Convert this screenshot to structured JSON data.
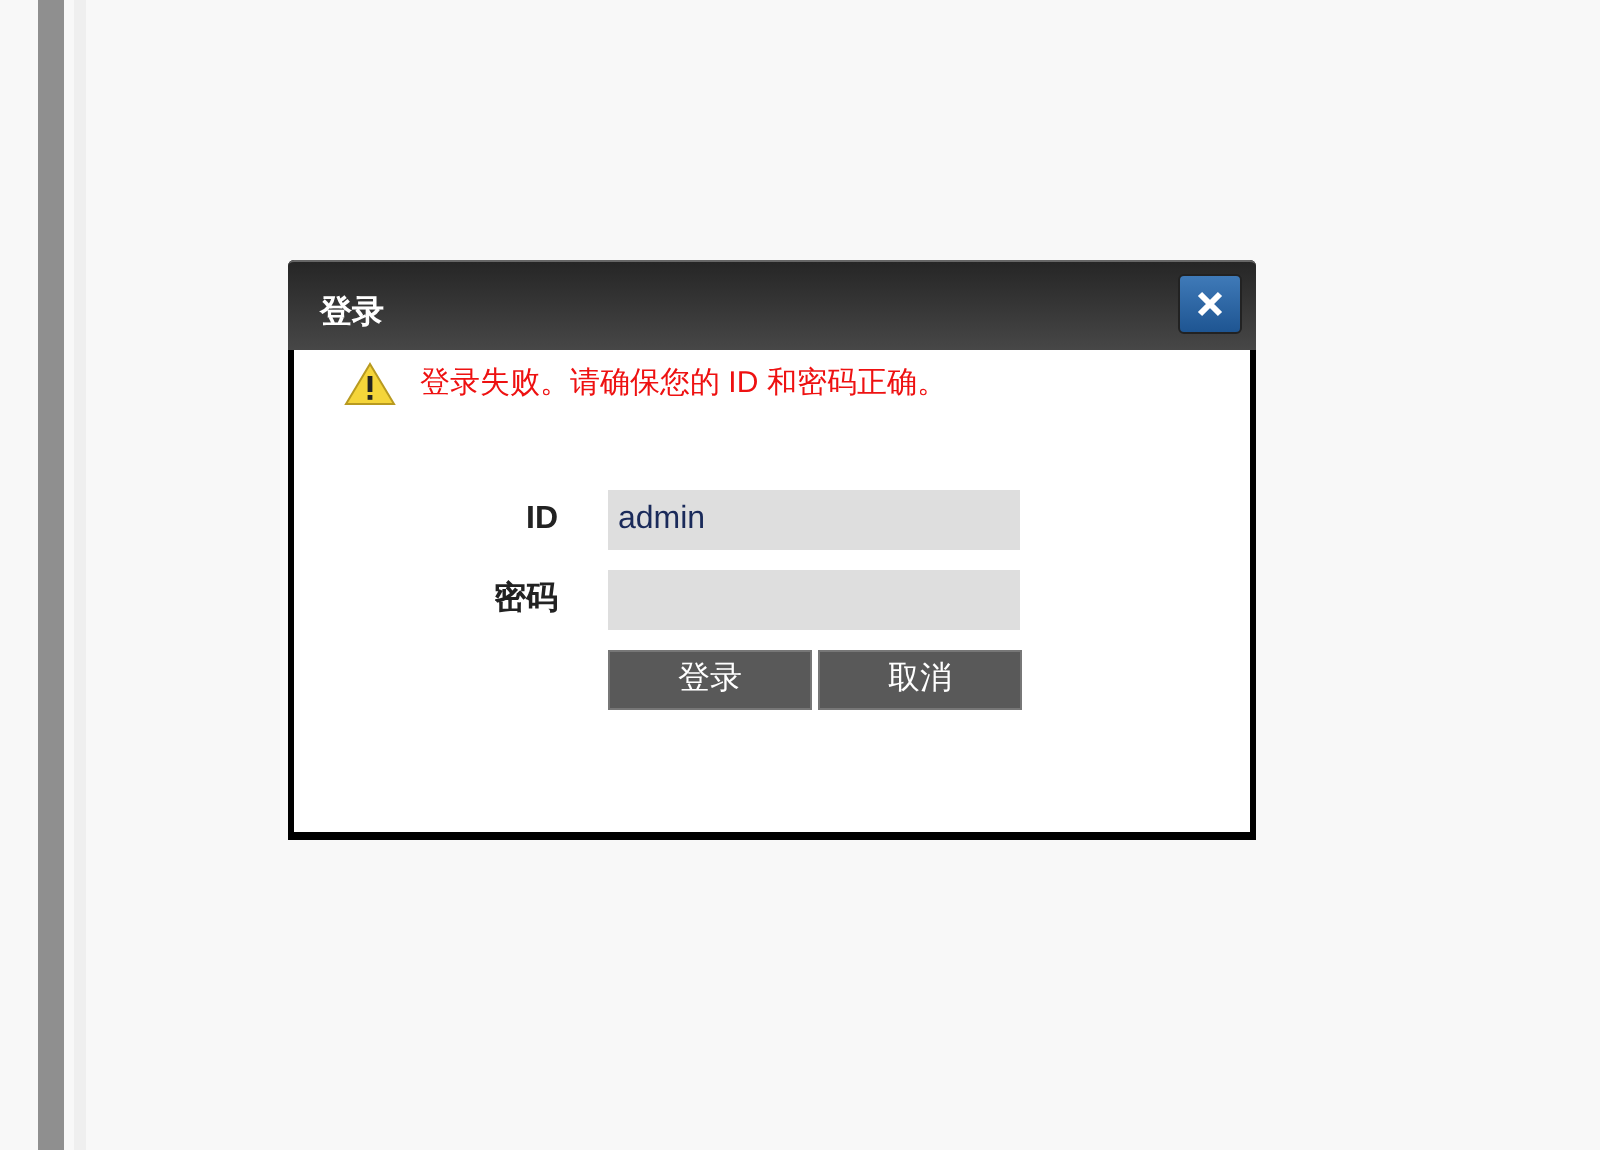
{
  "dialog": {
    "title": "登录",
    "error": "登录失败。请确保您的 ID 和密码正确。",
    "fields": [
      {
        "label": "ID",
        "value": "admin"
      },
      {
        "label": "密码"
      }
    ],
    "buttons": [
      "登录",
      "取消"
    ]
  }
}
